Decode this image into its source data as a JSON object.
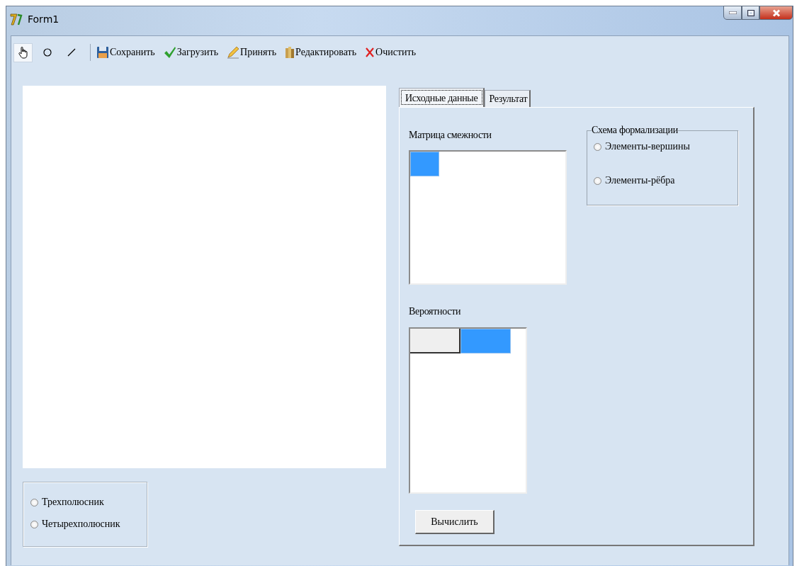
{
  "window": {
    "title": "Form1"
  },
  "toolbar": {
    "tools": [
      {
        "kind": "hand",
        "selected": true
      },
      {
        "kind": "circle",
        "selected": false
      },
      {
        "kind": "line",
        "selected": false
      }
    ],
    "buttons": [
      {
        "kind": "save",
        "label": "Сохранить"
      },
      {
        "kind": "load",
        "label": "Загрузить"
      },
      {
        "kind": "accept",
        "label": "Принять"
      },
      {
        "kind": "edit",
        "label": "Редактировать"
      },
      {
        "kind": "clear",
        "label": "Очистить"
      }
    ]
  },
  "pole_type": {
    "options": [
      {
        "label": "Трехполюсник",
        "checked": false
      },
      {
        "label": "Четырехполюсник",
        "checked": false
      }
    ]
  },
  "tabs": [
    {
      "label": "Исходные данные",
      "selected": true
    },
    {
      "label": "Результат",
      "selected": false
    }
  ],
  "adjacency_matrix": {
    "label": "Матрица смежности",
    "cells": [
      {
        "kind": "selected"
      }
    ]
  },
  "formalization": {
    "title": "Схема формализации",
    "options": [
      {
        "label": "Элементы-вершины",
        "checked": false
      },
      {
        "label": "Элементы-рёбра",
        "checked": false
      }
    ]
  },
  "probabilities": {
    "label": "Вероятности",
    "cells": [
      {
        "kind": "header"
      },
      {
        "kind": "selected"
      }
    ]
  },
  "compute_button": "Вычислить"
}
